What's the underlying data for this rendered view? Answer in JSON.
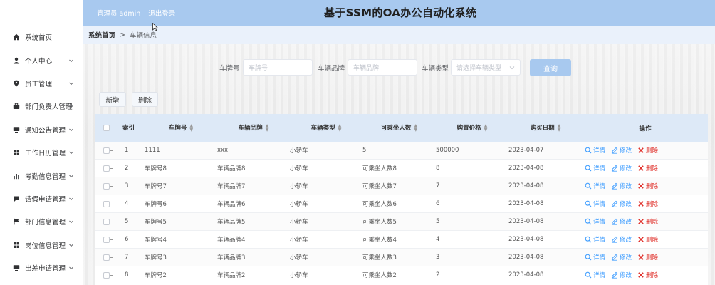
{
  "header": {
    "user_text": "管理员 admin",
    "logout_label": "退出登录",
    "title": "基于SSM的OA办公自动化系统"
  },
  "sidebar": {
    "items": [
      {
        "label": "系统首页",
        "icon": "home-icon",
        "expandable": false
      },
      {
        "label": "个人中心",
        "icon": "user-icon",
        "expandable": true
      },
      {
        "label": "员工管理",
        "icon": "location-icon",
        "expandable": true
      },
      {
        "label": "部门负责人管理",
        "icon": "briefcase-icon",
        "expandable": true
      },
      {
        "label": "通知公告管理",
        "icon": "monitor-icon",
        "expandable": true
      },
      {
        "label": "工作日历管理",
        "icon": "grid-icon",
        "expandable": true
      },
      {
        "label": "考勤信息管理",
        "icon": "chart-icon",
        "expandable": true
      },
      {
        "label": "请假申请管理",
        "icon": "message-icon",
        "expandable": true
      },
      {
        "label": "部门信息管理",
        "icon": "flag-icon",
        "expandable": true
      },
      {
        "label": "岗位信息管理",
        "icon": "grid-icon",
        "expandable": true
      },
      {
        "label": "出差申请管理",
        "icon": "monitor-icon",
        "expandable": true
      }
    ]
  },
  "breadcrumb": {
    "home": "系统首页",
    "separator": ">",
    "current": "车辆信息"
  },
  "search": {
    "plate_label": "车牌号",
    "plate_placeholder": "车牌号",
    "brand_label": "车辆品牌",
    "brand_placeholder": "车辆品牌",
    "type_label": "车辆类型",
    "type_placeholder": "请选择车辆类型",
    "query_label": "查询"
  },
  "actions": {
    "add_label": "新增",
    "delete_label": "删除"
  },
  "table": {
    "headers": {
      "index": "索引",
      "plate": "车牌号",
      "brand": "车辆品牌",
      "type": "车辆类型",
      "seats": "可乘坐人数",
      "price": "购置价格",
      "date": "购买日期",
      "ops": "操作"
    },
    "op_labels": {
      "detail": "详情",
      "edit": "修改",
      "delete": "删除"
    },
    "rows": [
      {
        "index": "1",
        "plate": "1111",
        "brand": "xxx",
        "type": "小轿车",
        "seats": "5",
        "price": "500000",
        "date": "2023-04-07"
      },
      {
        "index": "2",
        "plate": "车牌号8",
        "brand": "车辆品牌8",
        "type": "小轿车",
        "seats": "可乘坐人数8",
        "price": "8",
        "date": "2023-04-08"
      },
      {
        "index": "3",
        "plate": "车牌号7",
        "brand": "车辆品牌7",
        "type": "小轿车",
        "seats": "可乘坐人数7",
        "price": "7",
        "date": "2023-04-08"
      },
      {
        "index": "4",
        "plate": "车牌号6",
        "brand": "车辆品牌6",
        "type": "小轿车",
        "seats": "可乘坐人数6",
        "price": "6",
        "date": "2023-04-08"
      },
      {
        "index": "5",
        "plate": "车牌号5",
        "brand": "车辆品牌5",
        "type": "小轿车",
        "seats": "可乘坐人数5",
        "price": "5",
        "date": "2023-04-08"
      },
      {
        "index": "6",
        "plate": "车牌号4",
        "brand": "车辆品牌4",
        "type": "小轿车",
        "seats": "可乘坐人数4",
        "price": "4",
        "date": "2023-04-08"
      },
      {
        "index": "7",
        "plate": "车牌号3",
        "brand": "车辆品牌3",
        "type": "小轿车",
        "seats": "可乘坐人数3",
        "price": "3",
        "date": "2023-04-08"
      },
      {
        "index": "8",
        "plate": "车牌号2",
        "brand": "车辆品牌2",
        "type": "小轿车",
        "seats": "可乘坐人数2",
        "price": "2",
        "date": "2023-04-08"
      }
    ]
  },
  "colors": {
    "header_bg": "#a8c9ef",
    "link_blue": "#409eff",
    "delete_red": "#e0322c",
    "table_head_bg": "#dde9f7"
  }
}
